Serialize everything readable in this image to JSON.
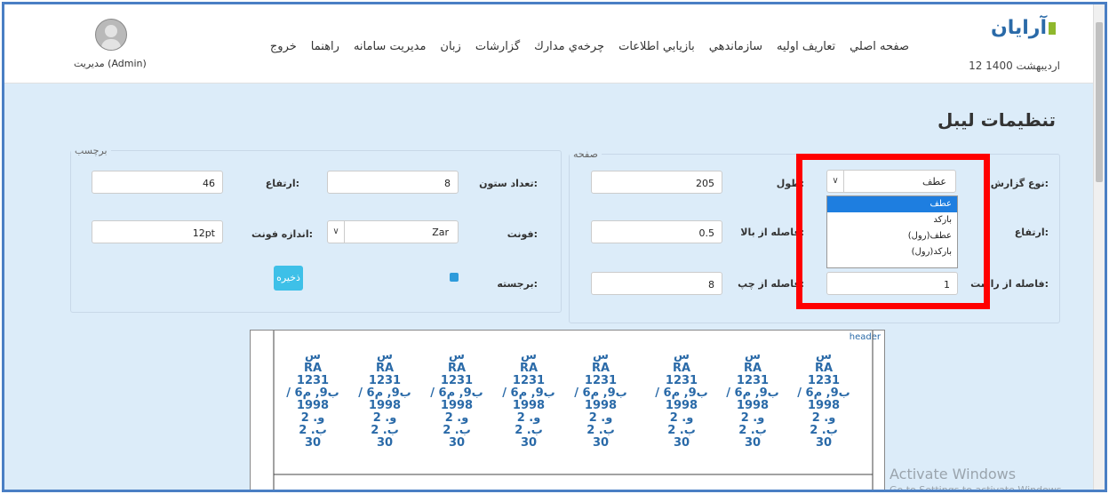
{
  "header": {
    "logo": "آرایان",
    "date": "12 اردیبهشت 1400",
    "nav_right": [
      "صفحه اصلي",
      "تعاريف اوليه",
      "سازماندهي",
      "بازيابي اطلاعات",
      "چرخه‌ي مدارك",
      "گزارشات",
      "زبان",
      "مديريت سامانه",
      "راهنما",
      "خروج"
    ],
    "user": "مدیریت (Admin)"
  },
  "page": {
    "title": "تنظیمات لیبل"
  },
  "page_group": {
    "legend": "صفحه",
    "print_type_label": "نوع گزارش:",
    "print_type_value": "عطف",
    "dropdown_options": [
      "عطف",
      "بارکد",
      "عطف(رول)",
      "بارکد(رول)"
    ],
    "length_label": "طول:",
    "length_value": "205",
    "height_label": "ارتفاع:",
    "top_margin_label": "فاصله از بالا:",
    "top_margin_value": "0.5",
    "right_margin_label": "فاصله از راست:",
    "right_margin_value": "1",
    "left_margin_label": "فاصله از چپ:",
    "left_margin_value": "8"
  },
  "label_group": {
    "legend": "برچسب",
    "columns_label": "تعداد ستون:",
    "columns_value": "8",
    "height_label": "ارتفاع:",
    "height_value": "46",
    "font_label": "فونت:",
    "font_value": "Zar",
    "font_size_label": "اندازه فونت:",
    "font_size_value": "12pt",
    "bold_label": "برجسته:",
    "save_label": "ذخیره"
  },
  "preview": {
    "header_text": "header",
    "cell_lines": [
      "س",
      "RA",
      "1231",
      "/ ب9, م6",
      "1998",
      "و. 2",
      "ب. 2",
      "30"
    ]
  },
  "watermark": {
    "line1": "Activate Windows",
    "line2": "Go to Settings to activate Windows."
  }
}
